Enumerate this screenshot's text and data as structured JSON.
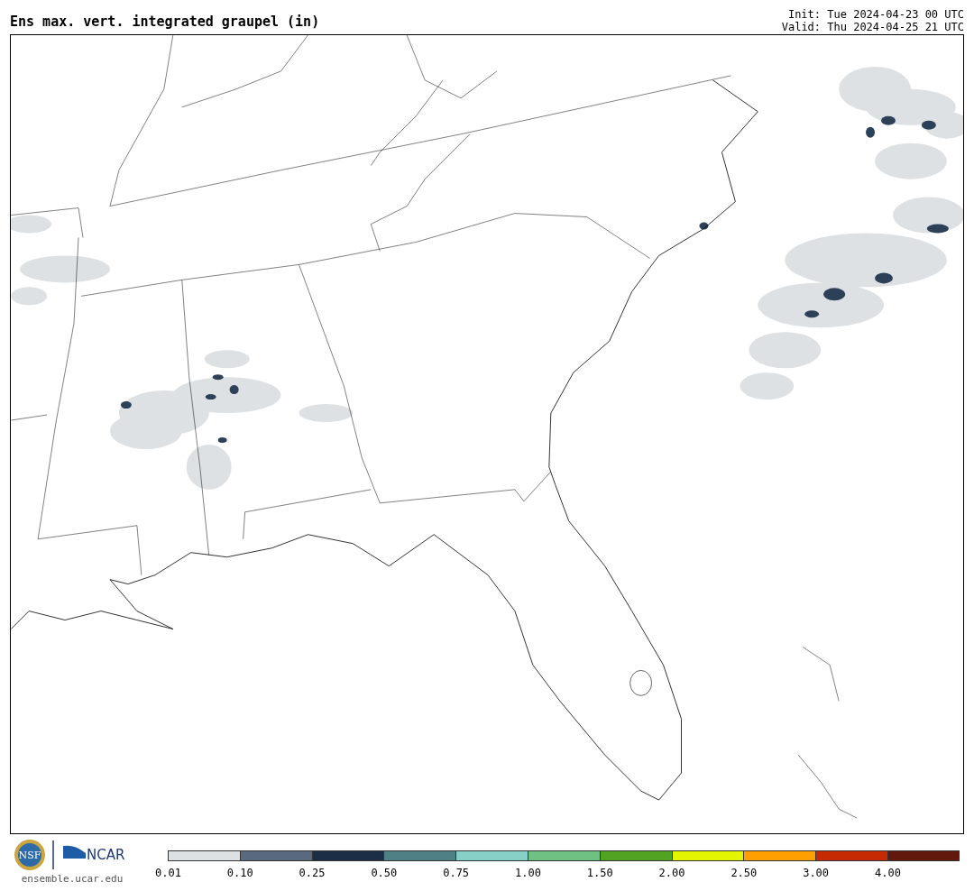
{
  "title": "Ens max. vert. integrated graupel (in)",
  "init": "Init: Tue 2024-04-23 00 UTC",
  "valid": "Valid: Thu 2024-04-25 21 UTC",
  "logo": {
    "nsf": "NSF",
    "ncar": "NCAR",
    "url": "ensemble.ucar.edu"
  },
  "colorbar": [
    {
      "label": "0.01",
      "color": "#dde1e4"
    },
    {
      "label": "0.10",
      "color": "#596a7e"
    },
    {
      "label": "0.25",
      "color": "#1b2e46"
    },
    {
      "label": "0.50",
      "color": "#4f8085"
    },
    {
      "label": "0.75",
      "color": "#86d0c8"
    },
    {
      "label": "1.00",
      "color": "#6ec083"
    },
    {
      "label": "1.50",
      "color": "#52a322"
    },
    {
      "label": "2.00",
      "color": "#e3f500"
    },
    {
      "label": "2.50",
      "color": "#ffa000"
    },
    {
      "label": "3.00",
      "color": "#c62a02"
    },
    {
      "label": "4.00",
      "color": "#62180c"
    }
  ]
}
